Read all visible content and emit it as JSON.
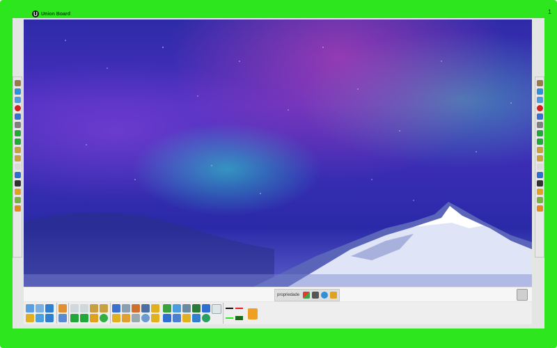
{
  "app": {
    "brand_name": "Union Board",
    "page_number": "1"
  },
  "properties_bar": {
    "label": "propriedade",
    "icons": [
      "color-grid-icon",
      "line-style-icon",
      "color-palette-icon",
      "swap-icon"
    ]
  },
  "left_sidebar": {
    "icons": [
      "pen-icon",
      "globe-icon",
      "gallery-icon",
      "record-icon",
      "save-icon",
      "stop-icon",
      "arrow-right-icon",
      "arrow-left-icon",
      "zoom-in-icon",
      "zoom-out-icon",
      "hand-icon",
      "marker-blue-icon",
      "pencil-icon",
      "highlighter-icon",
      "brush-icon",
      "eraser-icon"
    ]
  },
  "right_sidebar": {
    "icons": [
      "pen-icon",
      "globe-icon",
      "gallery-icon",
      "record-icon",
      "save-icon",
      "stop-icon",
      "arrow-right-icon",
      "arrow-left-icon",
      "zoom-in-icon",
      "zoom-out-icon",
      "hand-icon",
      "marker-blue-icon",
      "pencil-icon",
      "highlighter-icon",
      "brush-icon",
      "eraser-icon"
    ]
  },
  "bottom_toolbar": {
    "row1": [
      "open-file-icon",
      "save-file-icon",
      "undo-icon",
      "pointer-icon",
      "new-page-icon",
      "delete-page-icon",
      "zoom-in-icon",
      "zoom-out-icon",
      "screen-icon",
      "image-icon",
      "paint-icon",
      "film-icon",
      "bell-icon",
      "recycle-icon",
      "gallery-icon",
      "print-icon",
      "camera-icon",
      "keyboard-icon"
    ],
    "row2": [
      "folder-icon",
      "copy-icon",
      "redo-icon",
      "screen-share-icon",
      "arrow-left-icon",
      "arrow-right-icon",
      "hand-icon",
      "add-icon",
      "search-icon",
      "camera-icon",
      "calculator-icon",
      "clock-icon",
      "protractor-icon",
      "ruler-icon",
      "pen-icon",
      "pencil-icon",
      "text-icon",
      "user-icon",
      "web-icon"
    ],
    "line_colors": [
      "#111111",
      "#e02020",
      "#2ee61e",
      "#1a6b1a"
    ],
    "extra_icon": "layers-icon"
  },
  "colors": {
    "frame": "#2ee61e",
    "toolbar": "#eeeeee",
    "sidebar": "#e7e7e7"
  }
}
